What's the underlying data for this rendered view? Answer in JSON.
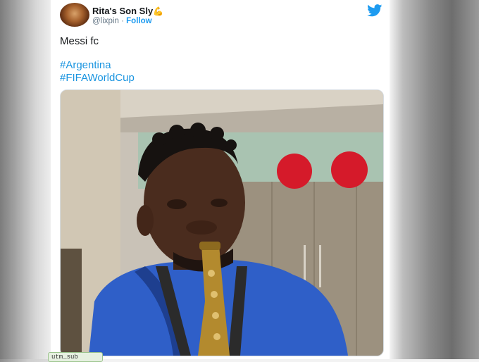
{
  "tweet": {
    "display_name": "Rita's Son Sly",
    "name_emoji": "💪",
    "handle": "@lixpin",
    "separator": "·",
    "follow_label": "Follow",
    "text": "Messi fc",
    "hashtags": [
      "#Argentina",
      "#FIFAWorldCup"
    ],
    "media_alt": "man in blue shirt holding saxophone"
  },
  "footer_tag": "utm_sub",
  "colors": {
    "link": "#1b95e0",
    "follow": "#1d9bf0",
    "name": "#14171a",
    "handle": "#657786",
    "shirt": "#2f5fc8"
  },
  "icons": {
    "platform": "twitter-bird-icon"
  }
}
